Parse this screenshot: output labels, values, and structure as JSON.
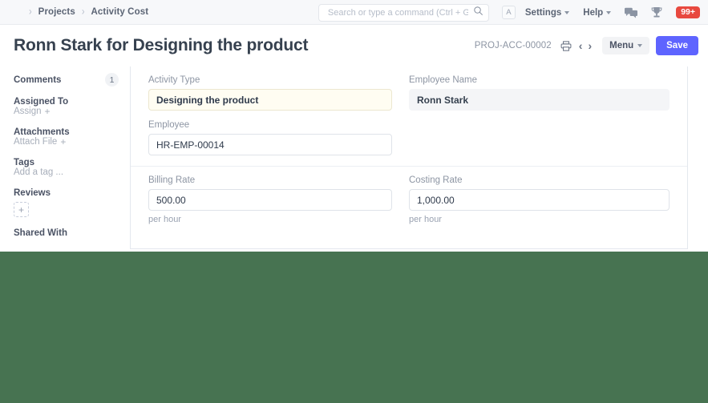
{
  "navbar": {
    "breadcrumb": [
      {
        "label": "Projects"
      },
      {
        "label": "Activity Cost"
      }
    ],
    "search": {
      "placeholder": "Search or type a command (Ctrl + G)",
      "value": "",
      "icon": "search-icon"
    },
    "avatar_initial": "A",
    "menus": [
      {
        "label": "Settings"
      },
      {
        "label": "Help"
      }
    ],
    "icons": [
      {
        "name": "chat-icon"
      },
      {
        "name": "trophy-icon"
      }
    ],
    "notification_badge": "99+",
    "badge_color": "#e8493f"
  },
  "page_head": {
    "title": "Ronn Stark for Designing the product",
    "doc_id": "PROJ-ACC-00002",
    "print_icon": "printer-icon",
    "prev_label": "‹",
    "next_label": "›",
    "menu_label": "Menu",
    "save_label": "Save",
    "save_color": "#5e64ff"
  },
  "sidebar": {
    "groups": [
      {
        "heading": "Comments",
        "count": "1"
      },
      {
        "heading": "Assigned To",
        "action": "Assign",
        "action_icon": "plus-icon"
      },
      {
        "heading": "Attachments",
        "action": "Attach File",
        "action_icon": "plus-icon"
      },
      {
        "heading": "Tags",
        "action": "Add a tag ..."
      },
      {
        "heading": "Reviews",
        "add_icon": "plus-icon"
      },
      {
        "heading": "Shared With"
      }
    ]
  },
  "form": {
    "sections": [
      {
        "left": [
          {
            "label": "Activity Type",
            "value": "Designing the product",
            "state": "modified"
          },
          {
            "label": "Employee",
            "value": "HR-EMP-00014",
            "state": "normal"
          }
        ],
        "right": [
          {
            "label": "Employee Name",
            "value": "Ronn Stark",
            "state": "readonly"
          }
        ]
      },
      {
        "left": [
          {
            "label": "Billing Rate",
            "value": "500.00",
            "state": "normal",
            "hint": "per hour"
          }
        ],
        "right": [
          {
            "label": "Costing Rate",
            "value": "1,000.00",
            "state": "normal",
            "hint": "per hour"
          }
        ]
      }
    ]
  },
  "background": {
    "band_color": "#477351"
  }
}
